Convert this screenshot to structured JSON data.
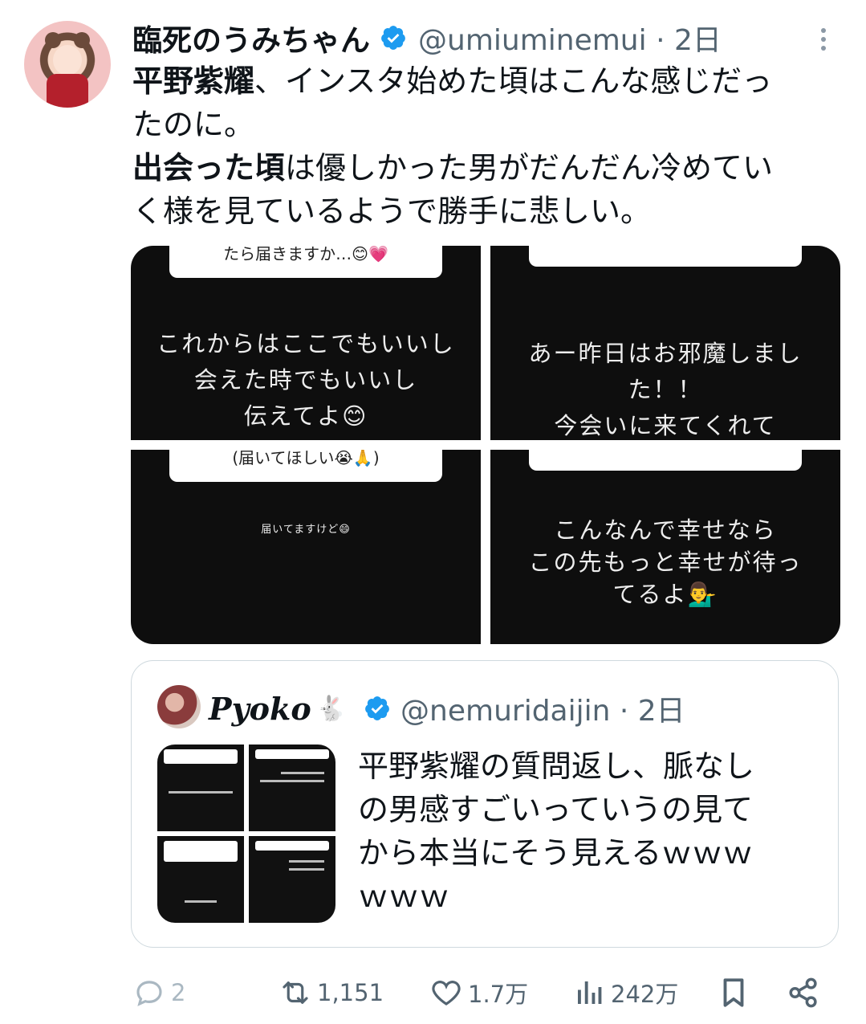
{
  "tweet": {
    "author_name": "臨死のうみちゃん",
    "author_handle": "@umiuminemui",
    "time_label": "· 2日",
    "text_lines": [
      {
        "bold": "平野紫耀",
        "rest": "、インスタ始めた頃はこんな感じだっ"
      },
      {
        "bold": "",
        "rest": "たのに。"
      },
      {
        "bold": "出会った頃",
        "rest": "は優しかった男がだんだん冷めてい"
      },
      {
        "bold": "",
        "rest": "く様を見ているようで勝手に悲しい。"
      }
    ],
    "media": [
      {
        "question": "たら届きますか…😊💗",
        "answer": "これからはここでもいいし\n会えた時でもいいし\n伝えてよ😊"
      },
      {
        "question": "",
        "answer": "あー昨日はお邪魔しまし\nた！！\n今会いに来てくれて"
      },
      {
        "question": "(届いてほしい😭🙏)",
        "answer": "届いてますけど😄"
      },
      {
        "question": "",
        "answer": "こんなんで幸せなら\nこの先もっと幸せが待っ\nてるよ💁‍♂️"
      }
    ]
  },
  "quote": {
    "author_name": "Pyoko",
    "author_emoji": "🐇",
    "author_handle": "@nemuridaijin",
    "time_label": "· 2日",
    "text_lines": [
      "平野紫耀の質問返し、脈なし",
      "の男感すごいっていうの見て",
      "から本当にそう見えるｗｗｗ",
      "ｗｗｗ"
    ]
  },
  "actions": {
    "reply_count": "2",
    "retweet_count": "1,151",
    "like_count": "1.7万",
    "view_count": "242万"
  },
  "icons": {
    "verified": "verified-badge-icon",
    "more": "more-dots-icon",
    "reply": "reply-bubble-icon",
    "retweet": "retweet-icon",
    "like": "heart-icon",
    "views": "views-bar-chart-icon",
    "bookmark": "bookmark-icon",
    "share": "share-icon"
  },
  "colors": {
    "verified_blue": "#1d9bf0",
    "muted_text": "#536471",
    "tile_bg": "#0e0e0e"
  }
}
